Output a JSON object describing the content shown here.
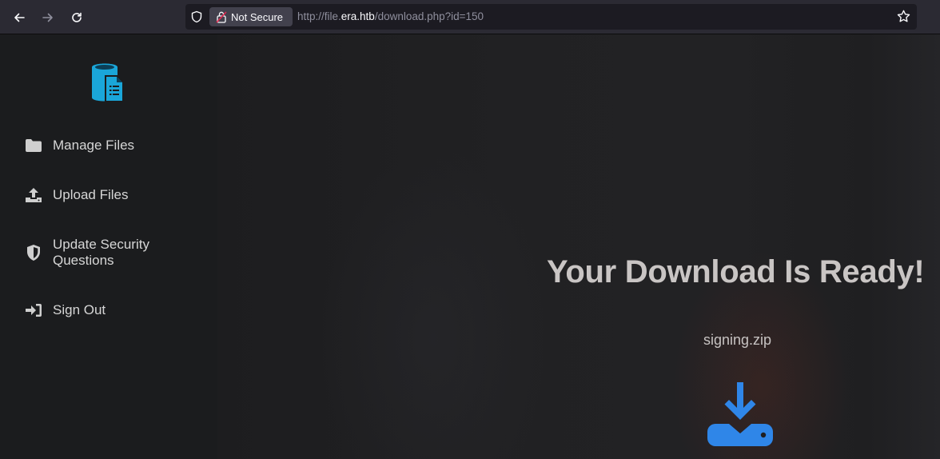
{
  "browser": {
    "security_label": "Not Secure",
    "url_prefix": "http://file.",
    "url_host": "era.htb",
    "url_path": "/download.php?id=150"
  },
  "sidebar": {
    "items": [
      {
        "label": "Manage Files",
        "icon": "folder-icon"
      },
      {
        "label": "Upload Files",
        "icon": "upload-icon"
      },
      {
        "label": "Update Security Questions",
        "icon": "shield-icon"
      },
      {
        "label": "Sign Out",
        "icon": "sign-out-icon"
      }
    ]
  },
  "main": {
    "title": "Your Download Is Ready!",
    "filename": "signing.zip",
    "download_icon": "download-icon"
  },
  "colors": {
    "accent": "#2f86e8",
    "logo": "#1aa6d9",
    "sidebar_bg": "#1b1c1e",
    "toolbar_bg": "#2b2a33"
  }
}
